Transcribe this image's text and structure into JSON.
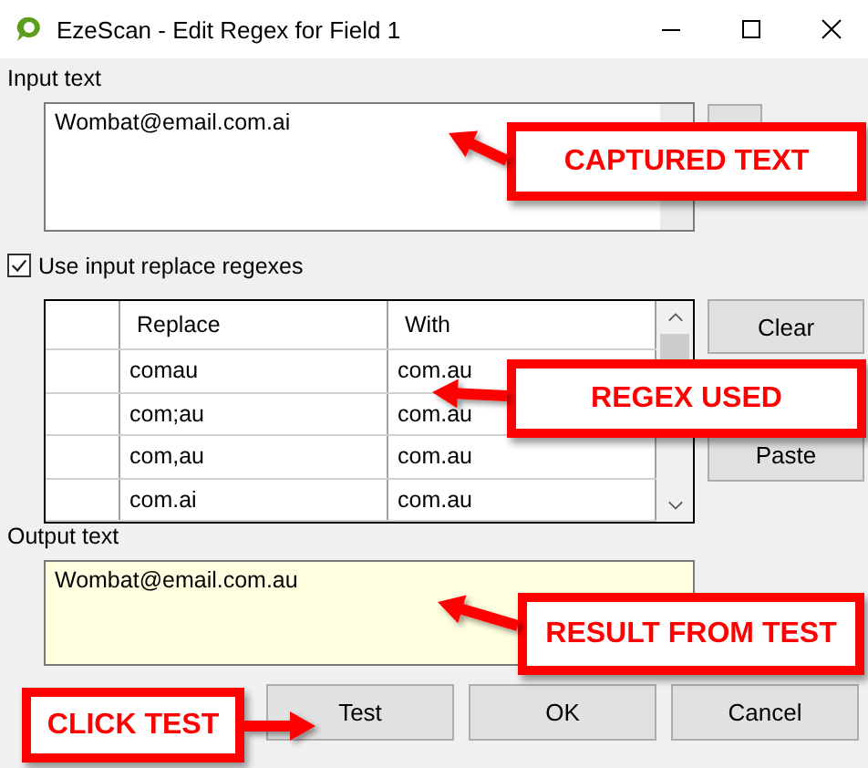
{
  "window": {
    "title": "EzeScan - Edit Regex for Field 1"
  },
  "input": {
    "label": "Input text",
    "value": "Wombat@email.com.ai"
  },
  "use_regexes": {
    "label": "Use input replace regexes",
    "checked": true
  },
  "table": {
    "columns": [
      "Replace",
      "With"
    ],
    "rows": [
      {
        "replace": "comau",
        "with": "com.au"
      },
      {
        "replace": "com;au",
        "with": "com.au"
      },
      {
        "replace": "com,au",
        "with": "com.au"
      },
      {
        "replace": "com.ai",
        "with": "com.au"
      }
    ]
  },
  "side_buttons": [
    "Clear",
    "Paste"
  ],
  "output": {
    "label": "Output text",
    "value": "Wombat@email.com.au"
  },
  "buttons": [
    "Test",
    "OK",
    "Cancel"
  ],
  "annotations": [
    {
      "text": "CAPTURED TEXT",
      "kind": "captured"
    },
    {
      "text": "REGEX USED",
      "kind": "regex"
    },
    {
      "text": "RESULT FROM TEST",
      "kind": "result"
    },
    {
      "text": "CLICK TEST",
      "kind": "click"
    }
  ]
}
